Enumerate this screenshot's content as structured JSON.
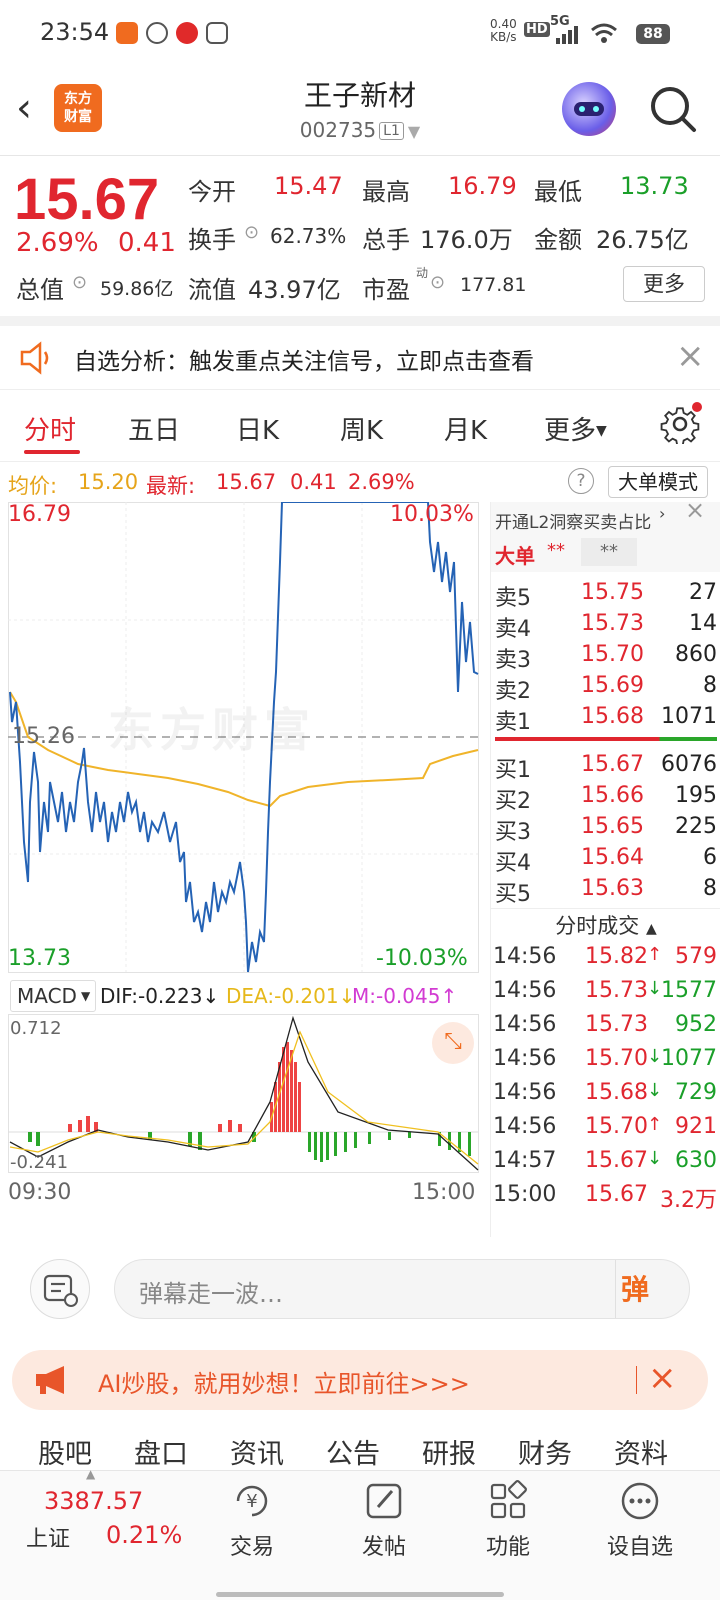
{
  "status": {
    "time": "23:54",
    "net_speed": "0.40",
    "net_unit": "KB/s",
    "hd": "HD",
    "signal": "5G",
    "battery": "88"
  },
  "header": {
    "logo_line1": "东方",
    "logo_line2": "财富",
    "name": "王子新材",
    "code": "002735",
    "level": "L1"
  },
  "quote": {
    "price": "15.67",
    "change_pct": "2.69%",
    "change_amt": "0.41",
    "open_label": "今开",
    "open": "15.47",
    "high_label": "最高",
    "high": "16.79",
    "low_label": "最低",
    "low": "13.73",
    "turnover_label": "换手",
    "turnover": "62.73%",
    "volume_label": "总手",
    "volume": "176.0万",
    "amount_label": "金额",
    "amount": "26.75亿",
    "mktcap_label": "总值",
    "mktcap": "59.86亿",
    "float_label": "流值",
    "float_cap": "43.97亿",
    "pe_label": "市盈",
    "pe_sup": "动",
    "pe": "177.81",
    "more_label": "更多"
  },
  "notice": {
    "text": "自选分析：触发重点关注信号，立即点击查看"
  },
  "tabs": [
    "分时",
    "五日",
    "日K",
    "周K",
    "月K",
    "更多"
  ],
  "info": {
    "avg_label": "均价:",
    "avg": "15.20",
    "latest_label": "最新:",
    "latest": "15.67",
    "chg": "0.41",
    "pct": "2.69%",
    "big_mode": "大单模式"
  },
  "chart_labels": {
    "top_price": "16.79",
    "top_pct": "10.03%",
    "mid_price": "15.26",
    "bot_price": "13.73",
    "bot_pct": "-10.03%",
    "watermark": "东方财富",
    "t_start": "09:30",
    "t_end": "15:00"
  },
  "macd": {
    "name": "MACD",
    "dif": "DIF:-0.223",
    "dea": "DEA:-0.201",
    "m": "M:-0.045",
    "top": "0.712",
    "bottom": "-0.241"
  },
  "chart_data": {
    "type": "line",
    "x": [
      "09:30",
      "15:00"
    ],
    "series": [],
    "ylim": [
      13.73,
      16.79
    ],
    "reference": 15.26
  },
  "book": {
    "promo": "开通L2洞察买卖占比",
    "bigorder": "大单",
    "stars1": "**",
    "stars2": "**",
    "asks": [
      {
        "label": "卖5",
        "price": "15.75",
        "vol": "27"
      },
      {
        "label": "卖4",
        "price": "15.73",
        "vol": "14"
      },
      {
        "label": "卖3",
        "price": "15.70",
        "vol": "860"
      },
      {
        "label": "卖2",
        "price": "15.69",
        "vol": "8"
      },
      {
        "label": "卖1",
        "price": "15.68",
        "vol": "1071"
      }
    ],
    "bids": [
      {
        "label": "买1",
        "price": "15.67",
        "vol": "6076"
      },
      {
        "label": "买2",
        "price": "15.66",
        "vol": "195"
      },
      {
        "label": "买3",
        "price": "15.65",
        "vol": "225"
      },
      {
        "label": "买4",
        "price": "15.64",
        "vol": "6"
      },
      {
        "label": "买5",
        "price": "15.63",
        "vol": "8"
      }
    ],
    "ticks_title": "分时成交",
    "ticks": [
      {
        "time": "14:56",
        "price": "15.82",
        "dir": "↑",
        "vol": "579",
        "c": "red"
      },
      {
        "time": "14:56",
        "price": "15.73",
        "dir": "↓",
        "vol": "1577",
        "c": "green"
      },
      {
        "time": "14:56",
        "price": "15.73",
        "dir": "",
        "vol": "952",
        "c": "green"
      },
      {
        "time": "14:56",
        "price": "15.70",
        "dir": "↓",
        "vol": "1077",
        "c": "green"
      },
      {
        "time": "14:56",
        "price": "15.68",
        "dir": "↓",
        "vol": "729",
        "c": "green"
      },
      {
        "time": "14:56",
        "price": "15.70",
        "dir": "↑",
        "vol": "921",
        "c": "red"
      },
      {
        "time": "14:57",
        "price": "15.67",
        "dir": "↓",
        "vol": "630",
        "c": "green"
      },
      {
        "time": "15:00",
        "price": "15.67",
        "dir": "",
        "vol": "3.2万",
        "c": "red"
      }
    ]
  },
  "comment": {
    "placeholder": "弹幕走一波…",
    "dan": "弹"
  },
  "ad": {
    "text": "AI炒股，就用妙想！立即前往>>>"
  },
  "subnav": [
    "股吧",
    "盘口",
    "资讯",
    "公告",
    "研报",
    "财务",
    "资料"
  ],
  "bottom": {
    "index_price": "3387.57",
    "index_name": "上证",
    "index_pct": "0.21%",
    "items": [
      "交易",
      "发帖",
      "功能",
      "设自选"
    ]
  }
}
